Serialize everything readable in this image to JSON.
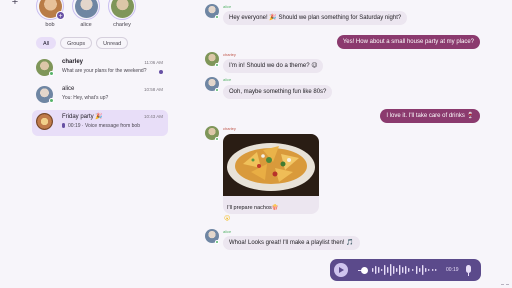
{
  "sidebar": {
    "add_icon": "plus-icon",
    "stories": [
      {
        "name": "bob",
        "color": "#d9a46b",
        "has_add": true
      },
      {
        "name": "alice",
        "color": "#7f97b3",
        "has_add": false
      },
      {
        "name": "charley",
        "color": "#8fa36a",
        "has_add": false
      }
    ],
    "filters": [
      "All",
      "Groups",
      "Unread"
    ],
    "active_filter": "All",
    "chats": [
      {
        "name": "charley",
        "time": "11:06 AM",
        "preview": "What are your plans for the weekend?",
        "unread": true,
        "selected": false,
        "avatar_color": "#8fa36a"
      },
      {
        "name": "alice",
        "time": "10:58 AM",
        "preview": "You: Hey, what's up?",
        "unread": false,
        "selected": false,
        "avatar_color": "#7f97b3"
      },
      {
        "name": "Friday party 🎉",
        "time": "10:43 AM",
        "preview": "00:19 · Voice message from bob",
        "unread": false,
        "selected": true,
        "avatar_color": "#c07b4a"
      }
    ]
  },
  "conversation": {
    "messages": [
      {
        "sender": "alice",
        "text": "Hey everyone! 🎉 Should we plan something for Saturday night?",
        "direction": "in"
      },
      {
        "sender": "",
        "text": "Yes! How about a small house party at my place?",
        "direction": "out"
      },
      {
        "sender": "charley",
        "text": "I'm in! Should we do a theme? 😉",
        "direction": "in"
      },
      {
        "sender": "alice",
        "text": "Ooh, maybe something fun like 80s?",
        "direction": "in"
      },
      {
        "sender": "",
        "text": "I love it. I'll take care of drinks 🍷",
        "direction": "out"
      },
      {
        "sender": "charley",
        "text": "I'll prepare nachos🍿",
        "direction": "in",
        "image": "nachos-photo"
      },
      {
        "sender": "alice",
        "text": "Whoa! Looks great! I'll make a playlist then! 🎵",
        "direction": "in"
      }
    ],
    "reaction": "😮",
    "voice_draft": {
      "time": "00:19",
      "play_icon": "play-icon",
      "mic_icon": "microphone-icon"
    }
  },
  "colors": {
    "accent": "#6750a4",
    "outgoing_bubble": "#8b3a6e",
    "incoming_bubble": "#ece6f0",
    "selected_chat": "#e8def8",
    "online": "#57b36a",
    "voice_bar": "#5b4a8b"
  }
}
